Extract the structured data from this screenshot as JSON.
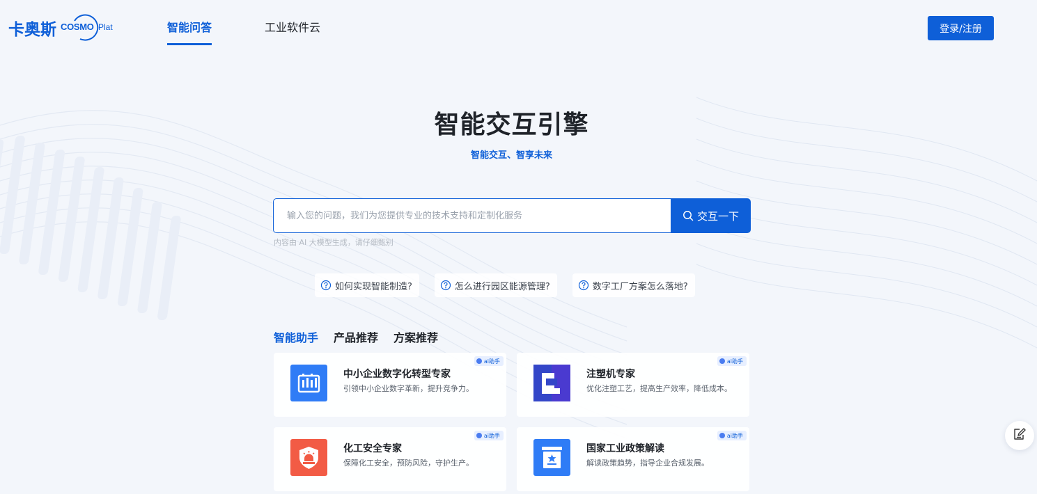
{
  "brand": {
    "name_cn": "卡奥斯",
    "name_en_main": "COSMO",
    "name_en_tail": "Plat"
  },
  "nav": {
    "items": [
      {
        "label": "智能问答",
        "active": true
      },
      {
        "label": "工业软件云",
        "active": false
      }
    ],
    "login_label": "登录/注册"
  },
  "hero": {
    "title": "智能交互引擎",
    "subtitle": "智能交互、智享未来"
  },
  "search": {
    "placeholder": "输入您的问题，我们为您提供专业的技术支持和定制化服务",
    "value": "",
    "button_label": "交互一下",
    "disclaimer": "内容由 AI 大模型生成，请仔细甄别"
  },
  "suggestions": [
    "如何实现智能制造?",
    "怎么进行园区能源管理?",
    "数字工厂方案怎么落地?"
  ],
  "tabs": [
    {
      "label": "智能助手",
      "active": true
    },
    {
      "label": "产品推荐",
      "active": false
    },
    {
      "label": "方案推荐",
      "active": false
    }
  ],
  "cards": [
    {
      "title": "中小企业数字化转型专家",
      "desc": "引领中小企业数字革新，提升竞争力。",
      "badge": "ai助手",
      "icon": "factory-chart-icon",
      "color": "#2f7cf6"
    },
    {
      "title": "注塑机专家",
      "desc": "优化注塑工艺，提高生产效率，降低成本。",
      "badge": "ai助手",
      "icon": "injection-machine-icon",
      "color": "#3346c8"
    },
    {
      "title": "化工安全专家",
      "desc": "保障化工安全，预防风险，守护生产。",
      "badge": "ai助手",
      "icon": "safety-alarm-icon",
      "color": "#f25b45"
    },
    {
      "title": "国家工业政策解读",
      "desc": "解读政策趋势，指导企业合规发展。",
      "badge": "ai助手",
      "icon": "policy-document-icon",
      "color": "#2f7cf6"
    }
  ],
  "icons": {
    "search": "search-icon",
    "question": "question-circle-icon",
    "feedback": "edit-note-icon"
  },
  "colors": {
    "accent": "#0e5fd8",
    "background": "#f3f6fb"
  }
}
